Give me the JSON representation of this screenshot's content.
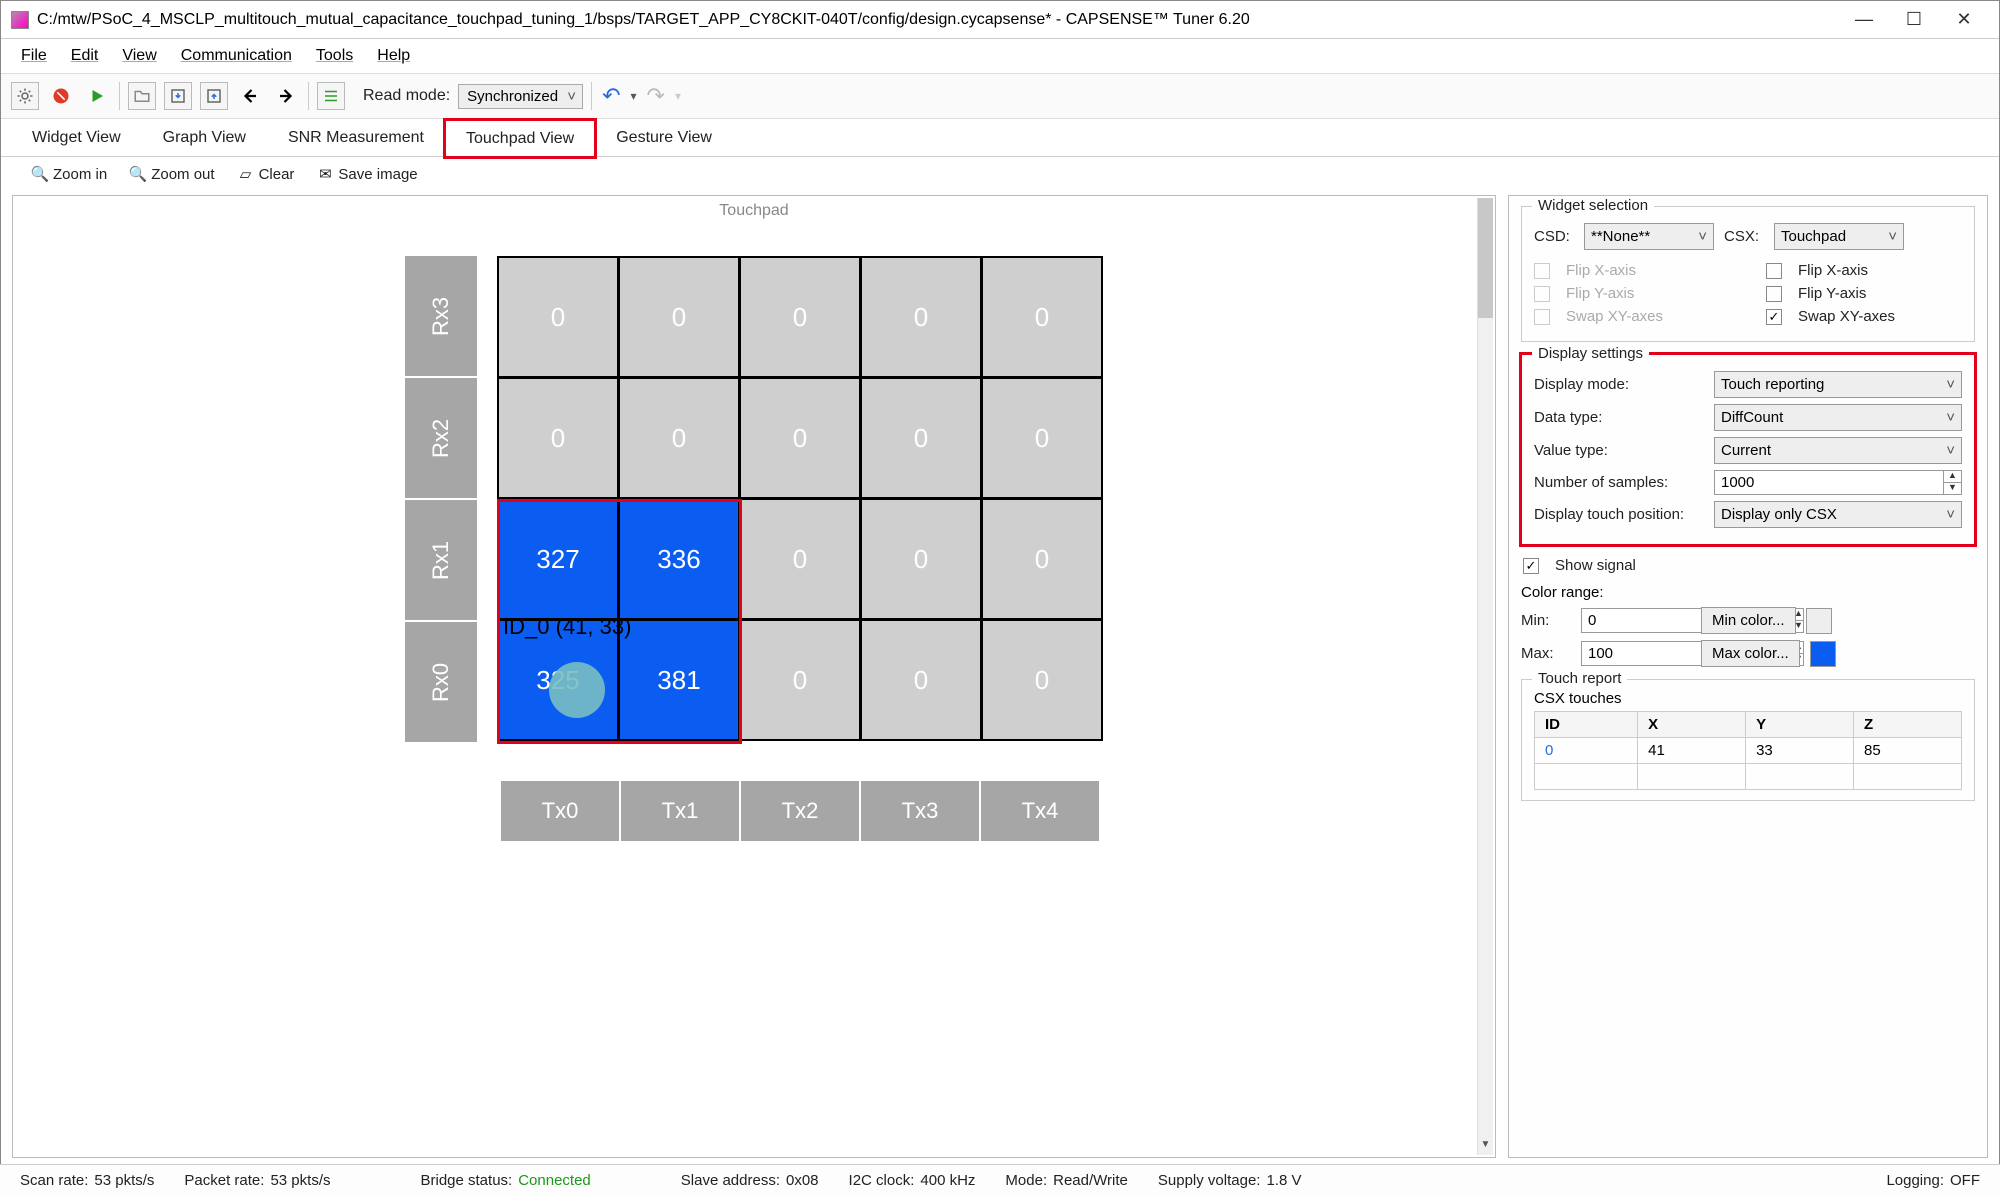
{
  "title": "C:/mtw/PSoC_4_MSCLP_multitouch_mutual_capacitance_touchpad_tuning_1/bsps/TARGET_APP_CY8CKIT-040T/config/design.cycapsense* - CAPSENSE™ Tuner 6.20",
  "menu": {
    "file": "File",
    "edit": "Edit",
    "view": "View",
    "comm": "Communication",
    "tools": "Tools",
    "help": "Help"
  },
  "toolbar": {
    "readmode_label": "Read mode:",
    "readmode_value": "Synchronized"
  },
  "tabs": {
    "widget": "Widget View",
    "graph": "Graph View",
    "snr": "SNR Measurement",
    "touchpad": "Touchpad View",
    "gesture": "Gesture View"
  },
  "subtoolbar": {
    "zoomin": "Zoom in",
    "zoomout": "Zoom out",
    "clear": "Clear",
    "save": "Save image"
  },
  "touchpad": {
    "title": "Touchpad",
    "rx": [
      "Rx3",
      "Rx2",
      "Rx1",
      "Rx0"
    ],
    "tx": [
      "Tx0",
      "Tx1",
      "Tx2",
      "Tx3",
      "Tx4"
    ],
    "grid": [
      [
        "0",
        "0",
        "0",
        "0",
        "0"
      ],
      [
        "0",
        "0",
        "0",
        "0",
        "0"
      ],
      [
        "327",
        "336",
        "0",
        "0",
        "0"
      ],
      [
        "325",
        "381",
        "0",
        "0",
        "0"
      ]
    ],
    "touchlabel": "ID_0 (41, 33)"
  },
  "right": {
    "widget_selection": {
      "legend": "Widget selection",
      "csd_label": "CSD:",
      "csd_value": "**None**",
      "csx_label": "CSX:",
      "csx_value": "Touchpad",
      "flipx": "Flip X-axis",
      "flipy": "Flip Y-axis",
      "swap": "Swap XY-axes"
    },
    "display": {
      "legend": "Display settings",
      "mode_label": "Display mode:",
      "mode_value": "Touch reporting",
      "data_label": "Data type:",
      "data_value": "DiffCount",
      "value_label": "Value type:",
      "value_value": "Current",
      "samples_label": "Number of samples:",
      "samples_value": "1000",
      "touchpos_label": "Display touch position:",
      "touchpos_value": "Display only CSX"
    },
    "show_signal": "Show signal",
    "color": {
      "legend": "Color range:",
      "min_label": "Min:",
      "min_value": "0",
      "min_btn": "Min color...",
      "max_label": "Max:",
      "max_value": "100",
      "max_btn": "Max color..."
    },
    "touch_report": {
      "legend": "Touch report",
      "csx_label": "CSX touches",
      "th": {
        "id": "ID",
        "x": "X",
        "y": "Y",
        "z": "Z"
      },
      "row": {
        "id": "0",
        "x": "41",
        "y": "33",
        "z": "85"
      }
    }
  },
  "status": {
    "scan_l": "Scan rate:",
    "scan_v": "53 pkts/s",
    "pkt_l": "Packet rate:",
    "pkt_v": "53 pkts/s",
    "bridge_l": "Bridge status:",
    "bridge_v": "Connected",
    "slave_l": "Slave address:",
    "slave_v": "0x08",
    "i2c_l": "I2C clock:",
    "i2c_v": "400 kHz",
    "mode_l": "Mode:",
    "mode_v": "Read/Write",
    "supply_l": "Supply voltage:",
    "supply_v": "1.8 V",
    "log_l": "Logging:",
    "log_v": "OFF"
  }
}
